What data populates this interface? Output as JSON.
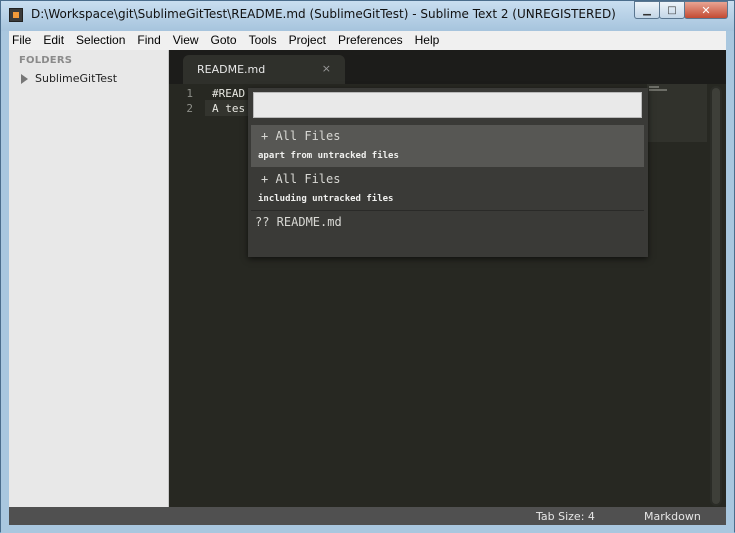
{
  "window": {
    "title": "D:\\Workspace\\git\\SublimeGitTest\\README.md (SublimeGitTest) - Sublime Text 2 (UNREGISTERED)",
    "minimize_glyph": "▁",
    "maximize_glyph": "□",
    "close_glyph": "✕"
  },
  "menu": {
    "items": [
      "File",
      "Edit",
      "Selection",
      "Find",
      "View",
      "Goto",
      "Tools",
      "Project",
      "Preferences",
      "Help"
    ]
  },
  "sidebar": {
    "header": "FOLDERS",
    "folders": [
      {
        "label": "SublimeGitTest"
      }
    ]
  },
  "tabs": [
    {
      "label": "README.md",
      "close_glyph": "×"
    }
  ],
  "editor": {
    "lines": [
      {
        "num": "1",
        "text": "#READ"
      },
      {
        "num": "2",
        "text": "A tes"
      }
    ]
  },
  "palette": {
    "input_value": "",
    "items": [
      {
        "title": "+ All Files",
        "subtitle": "apart from untracked files",
        "selected": true
      },
      {
        "title": "+ All Files",
        "subtitle": "including untracked files",
        "selected": false
      },
      {
        "title": "?? README.md",
        "subtitle": "",
        "selected": false
      }
    ]
  },
  "statusbar": {
    "tab_size": "Tab Size: 4",
    "syntax": "Markdown"
  },
  "colors": {
    "editor_bg": "#272822",
    "palette_bg": "#3a3a37",
    "palette_selected": "#575754",
    "statusbar_bg": "#505050",
    "sidebar_bg": "#e8e8e8"
  }
}
